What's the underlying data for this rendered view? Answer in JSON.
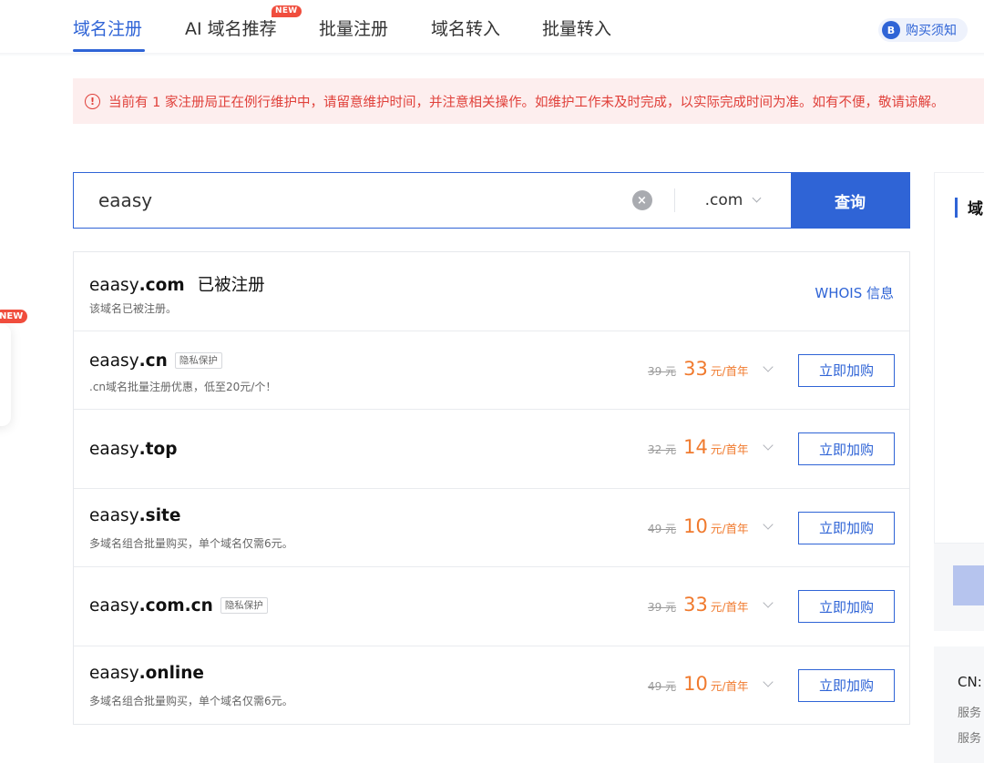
{
  "nav": {
    "tabs": [
      {
        "label": "域名注册"
      },
      {
        "label": "AI 域名推荐"
      },
      {
        "label": "批量注册"
      },
      {
        "label": "域名转入"
      },
      {
        "label": "批量转入"
      }
    ],
    "new_badge": "NEW",
    "notice_label": "购买须知",
    "notice_icon_letter": "B"
  },
  "alert": {
    "icon": "info-circle-icon",
    "text": "当前有 1 家注册局正在例行维护中，请留意维护时间，并注意相关操作。如维护工作未及时完成，以实际完成时间为准。如有不便，敬请谅解。"
  },
  "left_badge": "NEW",
  "search": {
    "value": "eaasy",
    "tld": ".com",
    "button": "查询"
  },
  "results": [
    {
      "name": "eaasy",
      "tld": ".com",
      "status": "已被注册",
      "sub": "该域名已被注册。",
      "whois": "WHOIS 信息"
    },
    {
      "name": "eaasy",
      "tld": ".cn",
      "tag": "隐私保护",
      "sub": ".cn域名批量注册优惠，低至20元/个！",
      "old_price": "39 元",
      "price": "33",
      "unit": "元/首年",
      "buy": "立即加购"
    },
    {
      "name": "eaasy",
      "tld": ".top",
      "old_price": "32 元",
      "price": "14",
      "unit": "元/首年",
      "buy": "立即加购"
    },
    {
      "name": "eaasy",
      "tld": ".site",
      "sub": "多域名组合批量购买，单个域名仅需6元。",
      "old_price": "49 元",
      "price": "10",
      "unit": "元/首年",
      "buy": "立即加购"
    },
    {
      "name": "eaasy",
      "tld": ".com.cn",
      "tag": "隐私保护",
      "old_price": "39 元",
      "price": "33",
      "unit": "元/首年",
      "buy": "立即加购"
    },
    {
      "name": "eaasy",
      "tld": ".online",
      "sub": "多域名组合批量购买，单个域名仅需6元。",
      "old_price": "49 元",
      "price": "10",
      "unit": "元/首年",
      "buy": "立即加购"
    }
  ],
  "right_panel": {
    "title": "域",
    "card2_title": "CN:",
    "card2_lines": [
      "服务",
      "服务"
    ]
  },
  "colors": {
    "accent": "#2f64d6",
    "price": "#f07a2e",
    "alert_text": "#e0403a",
    "alert_bg": "#fdeeee",
    "badge": "#f04d3d"
  }
}
